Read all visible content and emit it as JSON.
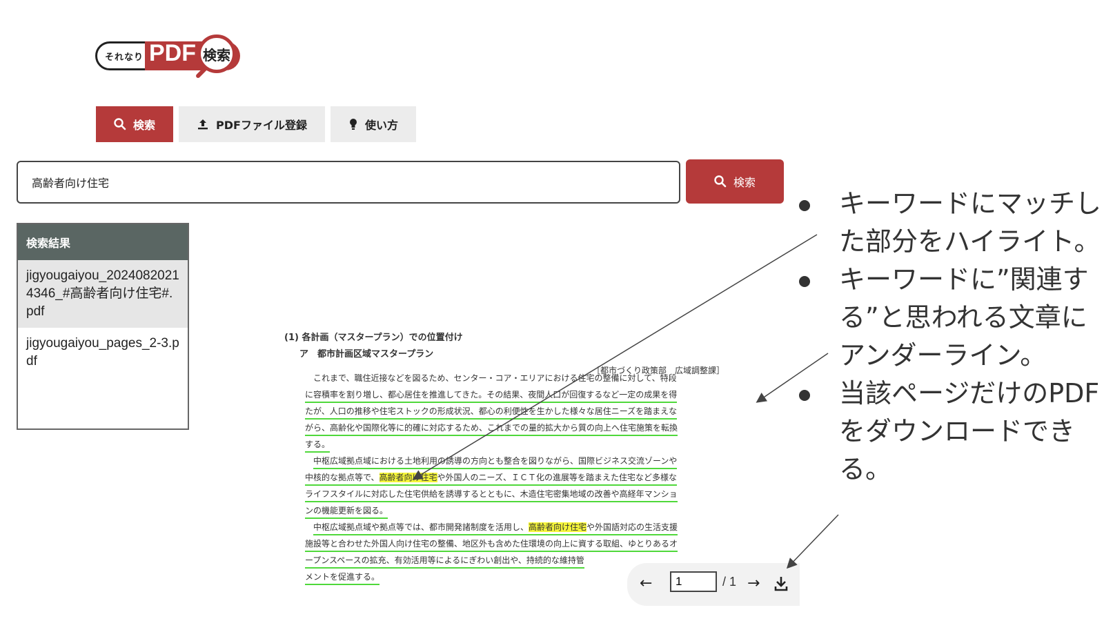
{
  "logo": {
    "small_text": "それなり",
    "pdf_text": "PDF",
    "search_text": "検索"
  },
  "nav": {
    "search_label": "検索",
    "register_label": "PDFファイル登録",
    "howto_label": "使い方"
  },
  "search": {
    "value": "高齢者向け住宅",
    "button_label": "検索"
  },
  "results": {
    "header": "検索結果",
    "items": [
      "jigyougaiyou_20240820214346_#高齢者向け住宅#.pdf",
      "jigyougaiyou_pages_2-3.pdf"
    ]
  },
  "document": {
    "heading1": "(1) 各計画（マスタープラン）での位置付け",
    "heading2": "ア　都市計画区域マスタープラン",
    "dept": "［都市づくり政策部　広域調整課］",
    "lines": [
      "これまで、職住近接などを図るため、センター・コア・エリアにおける住宅の整備に対して、特段",
      "に容積率を割り増し、都心居住を推進してきた。その結果、夜間人口が回復するなど一定の成果を得",
      "たが、人口の推移や住宅ストックの形成状況、都心の利便性を生かした様々な居住ニーズを踏まえな",
      "がら、高齢化や国際化等に的確に対応するため、これまでの量的拡大から質の向上へ住宅施策を転換",
      "する。",
      "中枢広域拠点域における土地利用の誘導の方向とも整合を図りながら、国際ビジネス交流ゾーンや",
      "中核的な拠点等で、",
      "高齢者向け住宅",
      "や外国人のニーズ、ＩＣＴ化の進展等を踏まえた住宅など多様な",
      "ライフスタイルに対応した住宅供給を誘導するとともに、木造住宅密集地域の改善や高経年マンショ",
      "ンの機能更新を図る。",
      "中枢広域拠点域や拠点等では、都市開発諸制度を活用し、",
      "や外国語対応の生活支援",
      "施設等と合わせた外国人向け住宅の整備、地区外も含めた住環境の向上に資する取組、ゆとりあるオ",
      "ープンスペースの拡充、有効活用等によるにぎわい創出や、持続的な維持管",
      "メントを促進する。"
    ]
  },
  "pdf_toolbar": {
    "page_value": "1",
    "total": "/ 1"
  },
  "annotations": [
    "キーワードにマッチした部分をハイライト。",
    "キーワードに”関連する”と思われる文章にアンダーライン。",
    "当該ページだけのPDFをダウンロードできる。"
  ],
  "colors": {
    "accent": "#b53a3a",
    "highlight": "#f6f63a",
    "underline": "#4fd83a",
    "results_header": "#5a6663"
  }
}
